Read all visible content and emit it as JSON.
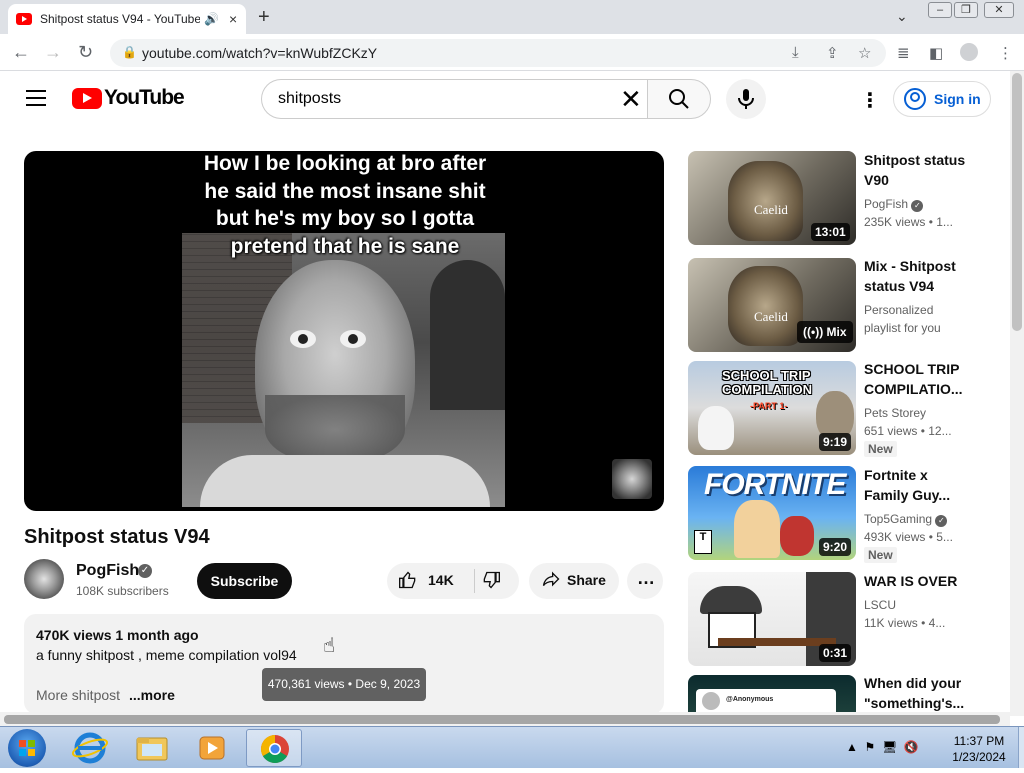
{
  "browser": {
    "tab_title": "Shitpost status V94 - YouTube",
    "url": "youtube.com/watch?v=knWubfZCKzY"
  },
  "youtube": {
    "logo_text": "YouTube",
    "search_value": "shitposts",
    "signin_label": "Sign in",
    "video": {
      "caption": "How I be looking at bro after he said the most insane shit but he's my boy so I gotta pretend that he is sane",
      "title": "Shitpost status V94",
      "channel": "PogFish",
      "subscribers": "108K subscribers",
      "subscribe_label": "Subscribe",
      "likes": "14K",
      "share_label": "Share",
      "desc_meta": "470K views  1 month ago",
      "desc_text": "a funny shitpost , meme compilation vol94",
      "desc_more_text": "More shitpost",
      "desc_more_link": "...more",
      "tooltip": "470,361 views • Dec 9, 2023"
    },
    "sidebar": [
      {
        "title_line1": "Shitpost status",
        "title_line2": "V90",
        "channel": "PogFish",
        "meta": "235K views  • 1...",
        "duration": "13:01",
        "thumb_text": "Caelid"
      },
      {
        "title_line1": "Mix - Shitpost",
        "title_line2": "status V94",
        "channel": "Personalized",
        "meta": "playlist for you",
        "duration": "Mix",
        "thumb_text": "Caelid"
      },
      {
        "title_line1": "SCHOOL TRIP",
        "title_line2": "COMPILATIO...",
        "channel": "Pets Storey",
        "meta": "651 views  • 12...",
        "badge": "New",
        "duration": "9:19",
        "thumb_text": "SCHOOL TRIP COMPILATION",
        "thumb_sub": "-PART 1-"
      },
      {
        "title_line1": "Fortnite x",
        "title_line2": "Family Guy...",
        "channel": "Top5Gaming",
        "meta": "493K views  • 5...",
        "badge": "New",
        "duration": "9:20",
        "thumb_text": "FORTNITE"
      },
      {
        "title_line1": "WAR IS OVER",
        "title_line2": "",
        "channel": "LSCU",
        "meta": "11K views  • 4...",
        "duration": "0:31"
      },
      {
        "title_line1": "When did your",
        "title_line2": "\"something's...",
        "channel": "",
        "meta": "",
        "thumb_text": "@Anonymous"
      }
    ]
  },
  "taskbar": {
    "time": "11:37 PM",
    "date": "1/23/2024"
  },
  "icons": {
    "tab_close": "×",
    "new_tab": "+",
    "back": "←",
    "forward": "→",
    "reload": "↻",
    "star": "☆",
    "kebab": "⋮",
    "like": "👍",
    "dislike": "👎",
    "share": "↪",
    "more": "…"
  }
}
